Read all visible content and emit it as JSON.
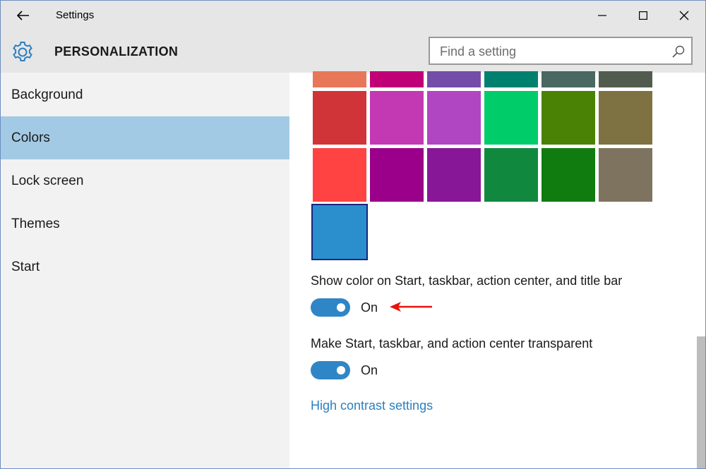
{
  "window": {
    "title": "Settings"
  },
  "header": {
    "section": "PERSONALIZATION"
  },
  "search": {
    "placeholder": "Find a setting",
    "value": ""
  },
  "sidebar": {
    "items": [
      {
        "label": "Background",
        "active": false
      },
      {
        "label": "Colors",
        "active": true
      },
      {
        "label": "Lock screen",
        "active": false
      },
      {
        "label": "Themes",
        "active": false
      },
      {
        "label": "Start",
        "active": false
      }
    ]
  },
  "colors": {
    "accent_palette": [
      [
        "#e8775a",
        "#bf0077",
        "#744da9",
        "#00816f",
        "#486860",
        "#515c4f"
      ],
      [
        "#d13438",
        "#c239b3",
        "#b146c2",
        "#00cc6a",
        "#498205",
        "#7e7242"
      ],
      [
        "#ff4343",
        "#9a0089",
        "#881798",
        "#10893e",
        "#107c10",
        "#7e735f"
      ],
      [
        "#2b8fcd"
      ]
    ],
    "selected_color": "#2b8fcd",
    "accent": "#2f86c6",
    "sidebar_active_bg": "#a3cae4",
    "link_color": "#2b7fc0"
  },
  "settings": {
    "show_color": {
      "label": "Show color on Start, taskbar, action center, and title bar",
      "state": "On",
      "value": true
    },
    "transparent": {
      "label": "Make Start, taskbar, and action center transparent",
      "state": "On",
      "value": true
    },
    "high_contrast_link": "High contrast settings"
  },
  "icons": {
    "back": "arrow-left",
    "gear": "gear",
    "search": "magnifier",
    "minimize": "minimize",
    "maximize": "maximize",
    "close": "close",
    "annotation": "red-arrow"
  }
}
